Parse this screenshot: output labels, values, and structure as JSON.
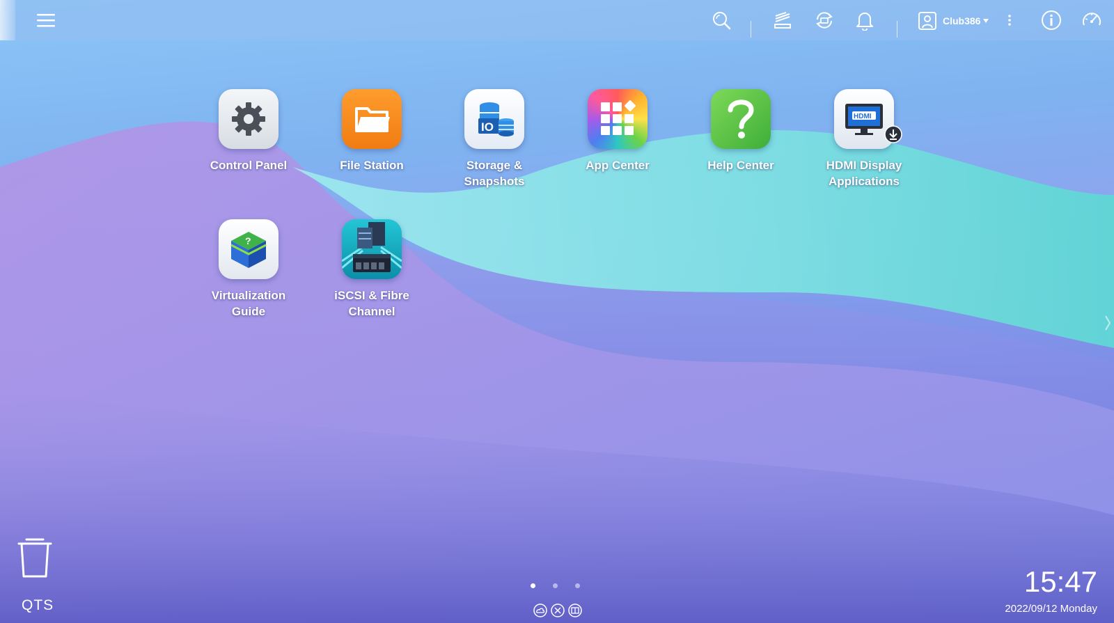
{
  "taskbar": {
    "user": {
      "name": "Club386"
    }
  },
  "desktop": {
    "apps": [
      {
        "label_line1": "Control Panel",
        "label_line2": "",
        "icon": "gear-icon"
      },
      {
        "label_line1": "File Station",
        "label_line2": "",
        "icon": "folder-icon"
      },
      {
        "label_line1": "Storage &",
        "label_line2": "Snapshots",
        "icon": "storage-icon"
      },
      {
        "label_line1": "App Center",
        "label_line2": "",
        "icon": "app-grid-icon"
      },
      {
        "label_line1": "Help Center",
        "label_line2": "",
        "icon": "question-icon"
      },
      {
        "label_line1": "HDMI Display",
        "label_line2": "Applications",
        "icon": "hdmi-monitor-icon"
      },
      {
        "label_line1": "Virtualization",
        "label_line2": "Guide",
        "icon": "cube-icon"
      },
      {
        "label_line1": "iSCSI & Fibre",
        "label_line2": "Channel",
        "icon": "server-icon"
      }
    ]
  },
  "footer": {
    "os_label": "QTS",
    "pages": 3,
    "active_page": 1,
    "time": "15:47",
    "date": "2022/09/12 Monday"
  },
  "colors": {
    "accent": "#ffffff",
    "control_panel_bg": "#e8ebef",
    "file_station_bg": "#f58a1f",
    "storage_bg": "#f2f6fb",
    "help_bg": "#5cc244",
    "iscsi_bg": "#1bb9c9"
  }
}
